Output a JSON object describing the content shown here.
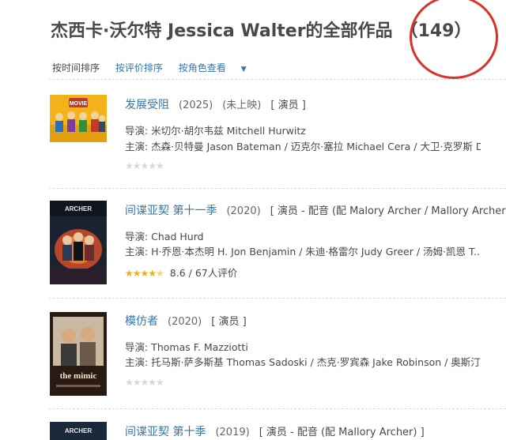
{
  "page": {
    "title": "杰西卡·沃尔特 Jessica Walter的全部作品",
    "count": "（149）"
  },
  "sort": {
    "by_time": "按时间排序",
    "by_rating": "按评价排序",
    "by_role": "按角色查看"
  },
  "films": [
    {
      "title": "发展受阻",
      "year": "(2025)",
      "status": "(未上映)",
      "role": "[ 演员 ]",
      "director": "导演: 米切尔·胡尔韦兹 Mitchell Hurwitz",
      "cast": "主演: 杰森·贝特曼 Jason Bateman / 迈克尔·塞拉 Michael Cera / 大卫·克罗斯 Da...",
      "rating_stars": 0,
      "rating_text": ""
    },
    {
      "title": "间谍亚契 第十一季",
      "year": "(2020)",
      "status": "",
      "role": "[ 演员 - 配音 (配 Malory Archer / Mallory Archer) ]",
      "director": "导演: Chad Hurd",
      "cast": "主演: H·乔恩·本杰明 H. Jon Benjamin / 朱迪·格雷尔 Judy Greer / 汤姆·凯恩 T...",
      "rating_stars": 4.5,
      "rating_text": "8.6 / 67人评价"
    },
    {
      "title": "模仿者",
      "year": "(2020)",
      "status": "",
      "role": "[ 演员 ]",
      "director": "导演: Thomas F. Mazziotti",
      "cast": "主演: 托马斯·萨多斯基 Thomas Sadoski / 杰克·罗宾森 Jake Robinson / 奥斯汀·...",
      "rating_stars": 0,
      "rating_text": "",
      "poster_text": "the mimic"
    },
    {
      "title": "间谍亚契 第十季",
      "year": "(2019)",
      "status": "",
      "role": "[ 演员 - 配音 (配 Mallory Archer) ]"
    }
  ],
  "posters": {
    "archer_label": "ARCHER",
    "movie_label": "MOVIE"
  },
  "colors": {
    "link": "#3377aa",
    "text": "#494949",
    "star": "#f5b100",
    "circle": "#d8322a"
  }
}
